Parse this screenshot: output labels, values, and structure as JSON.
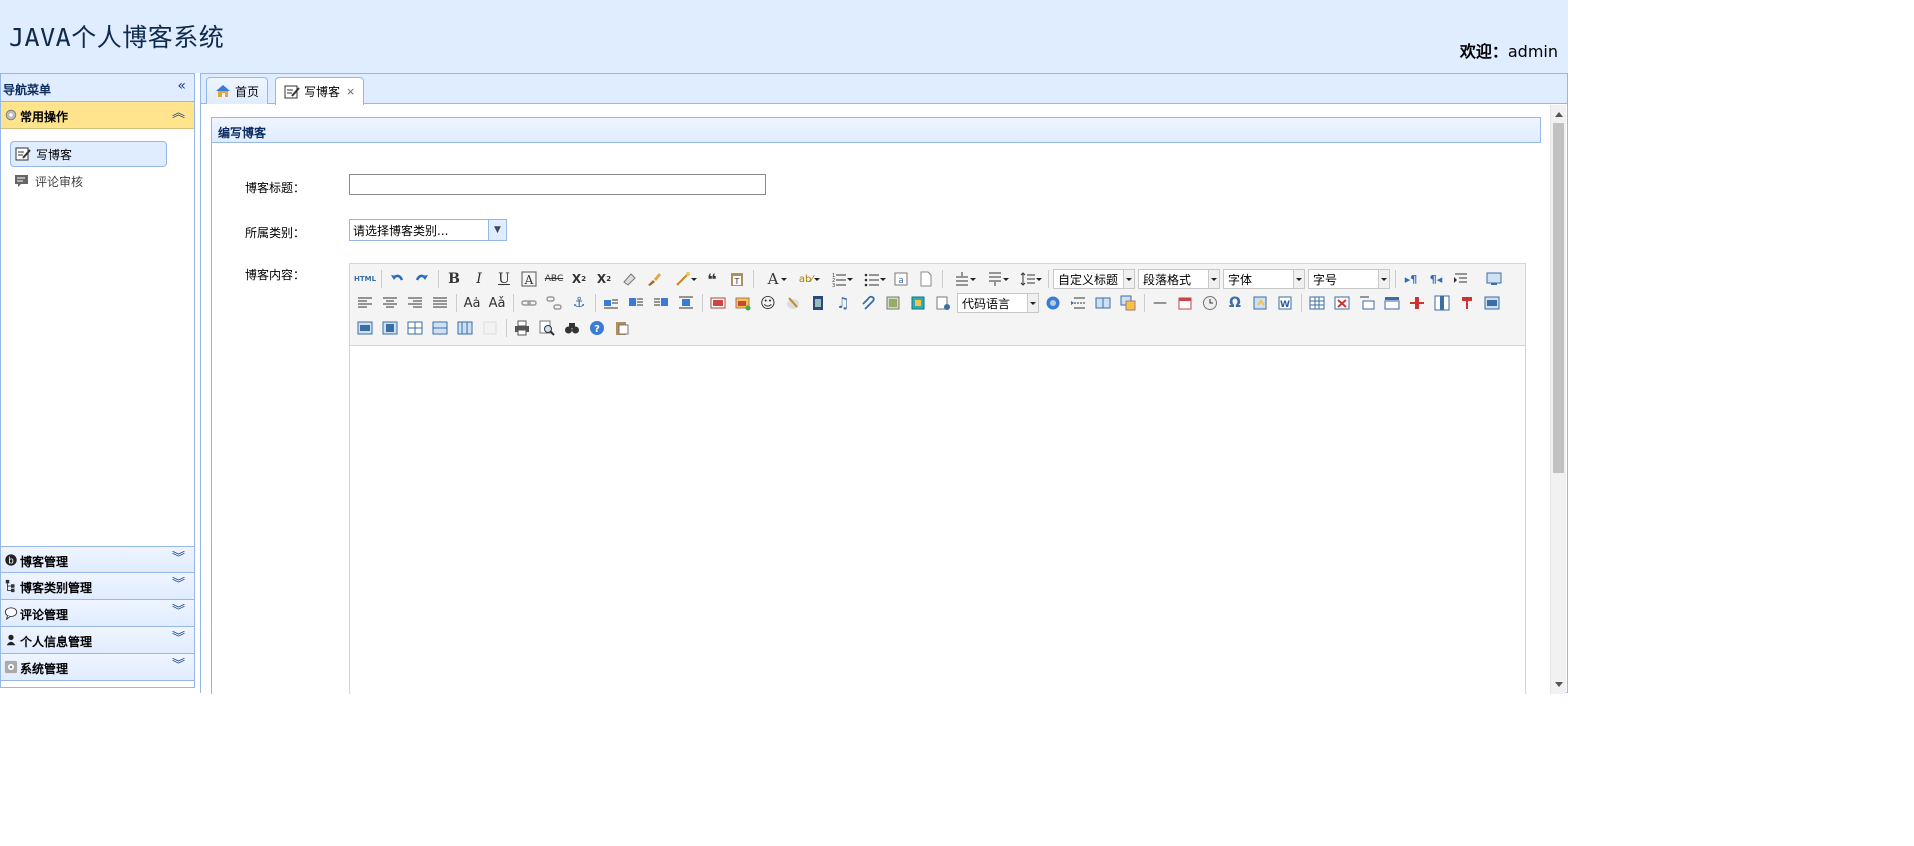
{
  "header": {
    "app_title": "JAVA个人博客系统",
    "welcome_label": "欢迎：",
    "username": "admin"
  },
  "sidebar": {
    "title": "导航菜单",
    "collapse_icon": "double-chevron-left-icon",
    "sections": [
      {
        "label": "常用操作",
        "icon": "gear-icon",
        "expanded": true,
        "items": [
          {
            "label": "写博客",
            "icon": "edit-note-icon",
            "selected": true
          },
          {
            "label": "评论审核",
            "icon": "comment-review-icon",
            "selected": false
          }
        ]
      },
      {
        "label": "博客管理",
        "icon": "blog-icon",
        "expanded": false
      },
      {
        "label": "博客类别管理",
        "icon": "tree-icon",
        "expanded": false
      },
      {
        "label": "评论管理",
        "icon": "speech-bubble-icon",
        "expanded": false
      },
      {
        "label": "个人信息管理",
        "icon": "user-icon",
        "expanded": false
      },
      {
        "label": "系统管理",
        "icon": "settings-icon",
        "expanded": false
      }
    ]
  },
  "tabs": [
    {
      "label": "首页",
      "icon": "home-icon",
      "closable": false,
      "active": false
    },
    {
      "label": "写博客",
      "icon": "edit-note-icon",
      "closable": true,
      "active": true,
      "close_glyph": "×"
    }
  ],
  "panel": {
    "title": "编写博客",
    "fields": {
      "title_label": "博客标题：",
      "title_value": "",
      "category_label": "所属类别：",
      "category_value": "请选择博客类别...",
      "content_label": "博客内容："
    }
  },
  "editor": {
    "selects": {
      "custom_heading": "自定义标题",
      "paragraph_format": "段落格式",
      "font_family": "字体",
      "font_size": "字号",
      "code_language": "代码语言"
    },
    "html_button": "HTML"
  },
  "colors": {
    "header_bg": "#e0ecff",
    "border": "#95b8e7",
    "active_section": "#ffe48d"
  }
}
